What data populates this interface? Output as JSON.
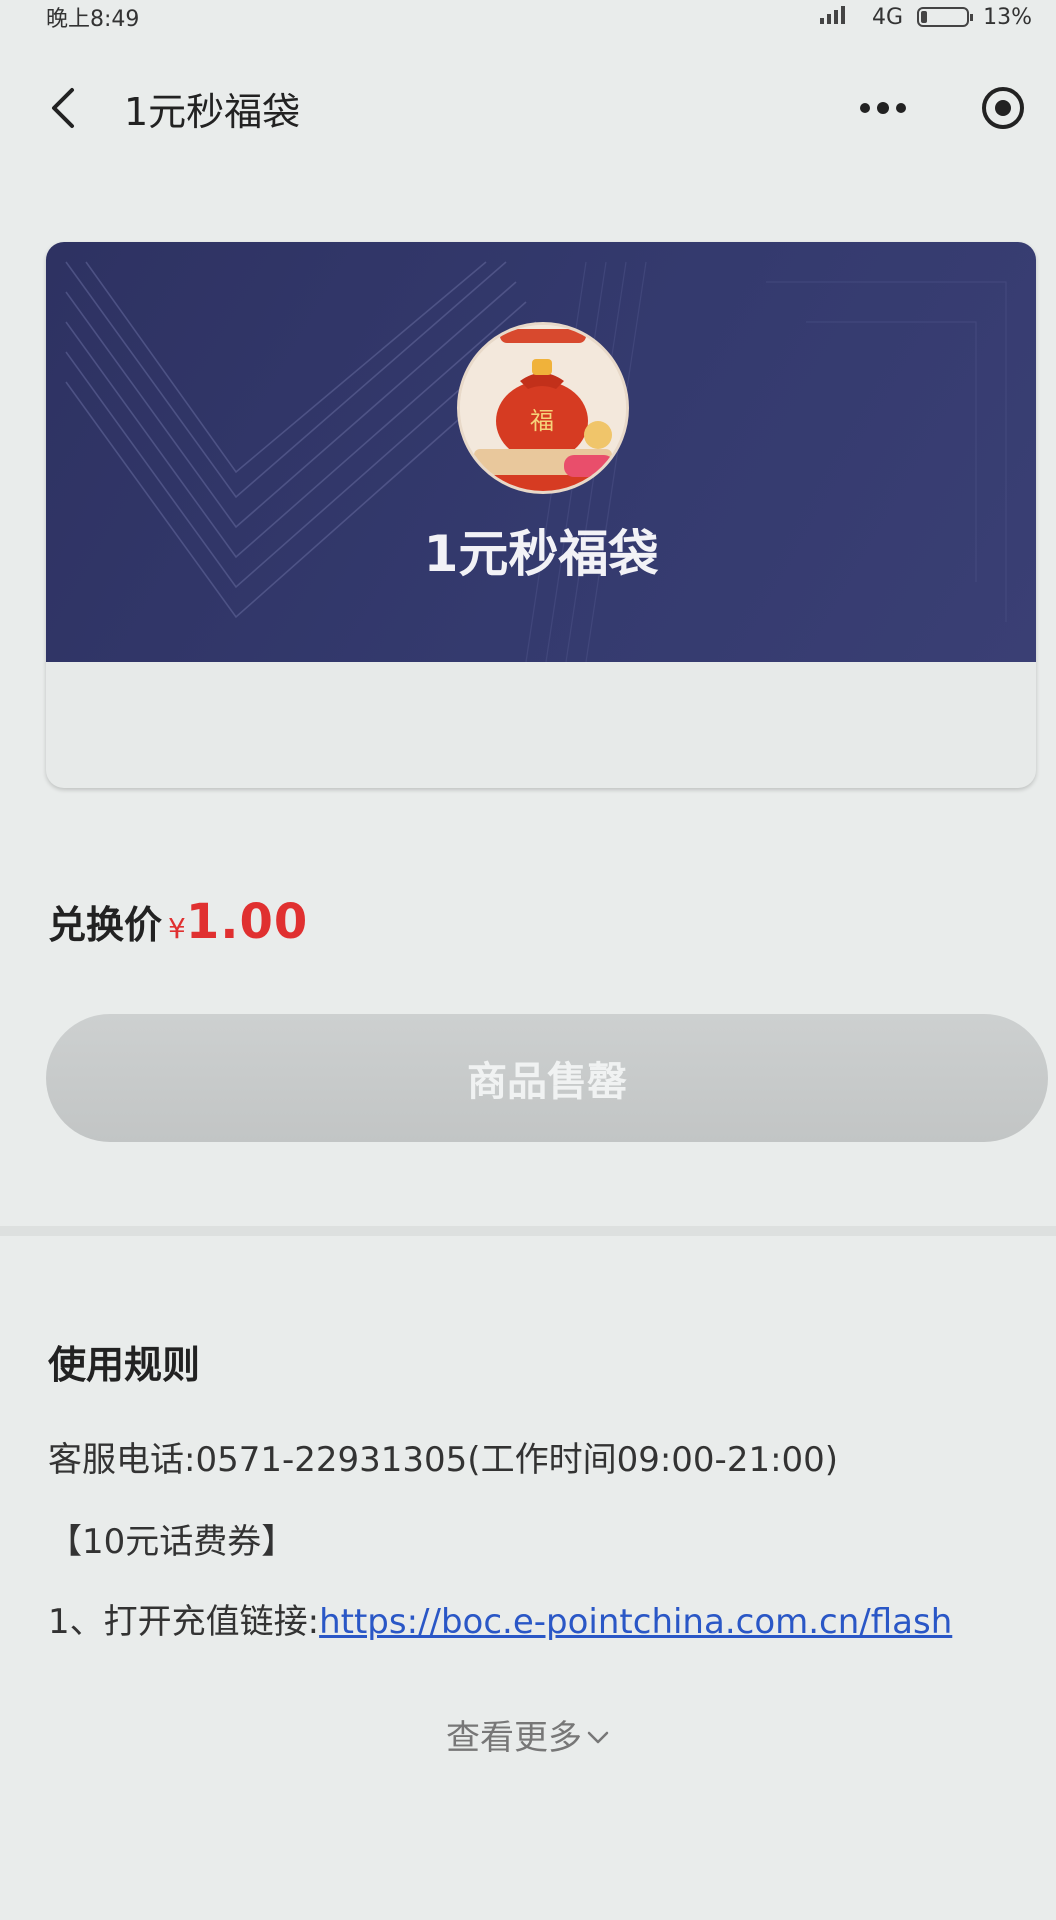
{
  "status_bar": {
    "time": "晚上8:49",
    "network": "4G",
    "battery_percent": "13%",
    "battery_level": 0.13
  },
  "nav": {
    "title": "1元秒福袋"
  },
  "product": {
    "name": "1元秒福袋",
    "image_badge_text": "福"
  },
  "price": {
    "label": "兑换价",
    "currency": "¥",
    "value": "1.00"
  },
  "action_button": {
    "label": "商品售罄"
  },
  "rules": {
    "title": "使用规则",
    "service_phone": "客服电话:0571-22931305(工作时间09:00-21:00)",
    "voucher_header": "【10元话费券】",
    "step1_prefix": "1、打开充值链接:",
    "step1_link": "https://boc.e-pointchina.com.cn/flash"
  },
  "view_more": {
    "label": "查看更多"
  },
  "colors": {
    "banner": "#2e3262",
    "price_red": "#e03030",
    "link_blue": "#2a57c6",
    "button_disabled": "#c8cbcb"
  }
}
